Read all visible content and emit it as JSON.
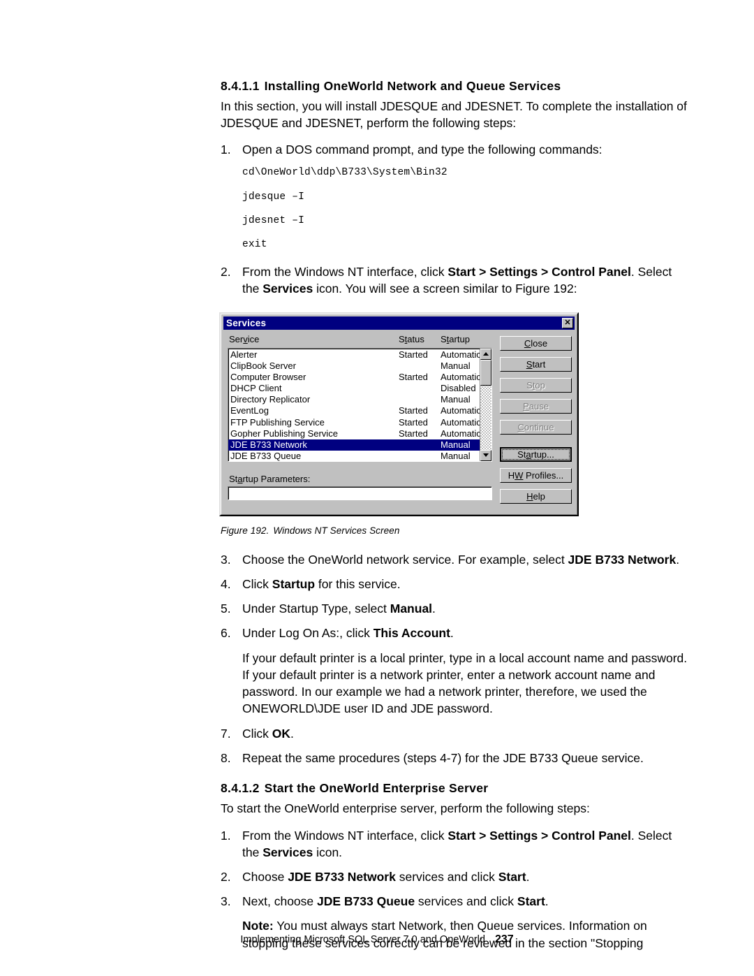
{
  "section_1": {
    "heading_number": "8.4.1.1",
    "heading_title": "Installing OneWorld Network and Queue Services",
    "intro": "In this section, you will install JDESQUE and JDESNET. To complete the installation of JDESQUE and JDESNET, perform the following steps:",
    "step1": {
      "marker": "1.",
      "text": "Open a DOS command prompt, and type the following commands:"
    },
    "commands": [
      "cd\\OneWorld\\ddp\\B733\\System\\Bin32",
      "jdesque –I",
      "jdesnet –I",
      "exit"
    ],
    "step2": {
      "marker": "2.",
      "part1": "From the Windows NT interface, click ",
      "bold1": "Start > Settings > Control Panel",
      "part2": ". Select the ",
      "bold2": "Services",
      "part3": " icon. You will see a screen similar to Figure 192:"
    },
    "step3": {
      "marker": "3.",
      "part1": "Choose the OneWorld network service. For example, select ",
      "bold1": "JDE B733 Network",
      "part2": "."
    },
    "step4": {
      "marker": "4.",
      "part1": "Click ",
      "bold1": "Startup",
      "part2": " for this service."
    },
    "step5": {
      "marker": "5.",
      "part1": "Under Startup Type, select ",
      "bold1": "Manual",
      "part2": "."
    },
    "step6": {
      "marker": "6.",
      "part1": "Under Log On As:, click ",
      "bold1": "This Account",
      "part2": "."
    },
    "printer_para": "If your default printer is a local printer, type in a local account name and password. If your default printer is a network printer, enter a network account name and password. In our example we had a network printer, therefore, we used the ONEWORLD\\JDE user ID and JDE password.",
    "step7": {
      "marker": "7.",
      "part1": "Click ",
      "bold1": "OK",
      "part2": "."
    },
    "step8": {
      "marker": "8.",
      "part1": "Repeat the same procedures (steps 4-7) for the JDE B733 Queue service.",
      "bold1": "",
      "part2": ""
    }
  },
  "figure": {
    "caption_number": "Figure 192.",
    "caption_text": "Windows NT Services Screen"
  },
  "services_dialog": {
    "title": "Services",
    "close_icon_label": "✕",
    "columns": {
      "service": {
        "pre": "Ser",
        "acc": "v",
        "post": "ice"
      },
      "status": {
        "pre": "S",
        "acc": "t",
        "post": "atus"
      },
      "startup": {
        "pre": "S",
        "acc": "t",
        "post": "artup"
      }
    },
    "rows": [
      {
        "name": "Alerter",
        "status": "Started",
        "startup": "Automatic",
        "selected": false
      },
      {
        "name": "ClipBook Server",
        "status": "",
        "startup": "Manual",
        "selected": false
      },
      {
        "name": "Computer Browser",
        "status": "Started",
        "startup": "Automatic",
        "selected": false
      },
      {
        "name": "DHCP Client",
        "status": "",
        "startup": "Disabled",
        "selected": false
      },
      {
        "name": "Directory Replicator",
        "status": "",
        "startup": "Manual",
        "selected": false
      },
      {
        "name": "EventLog",
        "status": "Started",
        "startup": "Automatic",
        "selected": false
      },
      {
        "name": "FTP Publishing Service",
        "status": "Started",
        "startup": "Automatic",
        "selected": false
      },
      {
        "name": "Gopher Publishing Service",
        "status": "Started",
        "startup": "Automatic",
        "selected": false
      },
      {
        "name": "JDE B733 Network",
        "status": "",
        "startup": "Manual",
        "selected": true
      },
      {
        "name": "JDE B733 Queue",
        "status": "",
        "startup": "Manual",
        "selected": false
      }
    ],
    "startup_parameters": {
      "label_pre": "St",
      "label_acc": "a",
      "label_post": "rtup Parameters:",
      "value": "",
      "placeholder": ""
    },
    "buttons": [
      {
        "pre": "",
        "acc": "C",
        "post": "lose",
        "disabled": false,
        "default": false
      },
      {
        "pre": "",
        "acc": "S",
        "post": "tart",
        "disabled": false,
        "default": false
      },
      {
        "pre": "S",
        "acc": "t",
        "post": "op",
        "disabled": true,
        "default": false
      },
      {
        "pre": "",
        "acc": "P",
        "post": "ause",
        "disabled": true,
        "default": false
      },
      {
        "pre": "",
        "acc": "C",
        "post": "ontinue",
        "disabled": true,
        "default": false
      },
      {
        "pre": "St",
        "acc": "a",
        "post": "rtup...",
        "disabled": false,
        "default": true
      },
      {
        "pre": "H",
        "acc": "W",
        "post": " Profiles...",
        "disabled": false,
        "default": false
      },
      {
        "pre": "",
        "acc": "H",
        "post": "elp",
        "disabled": false,
        "default": false
      }
    ],
    "colors": {
      "titlebar": "#000080",
      "face": "#c0c0c0",
      "selection": "#000080",
      "list_background": "#ffffff"
    }
  },
  "section_2": {
    "heading_number": "8.4.1.2",
    "heading_title": "Start the OneWorld Enterprise Server",
    "intro": "To start the OneWorld enterprise server, perform the following steps:",
    "step1": {
      "marker": "1.",
      "part1": "From the Windows NT interface, click ",
      "bold1": "Start > Settings > Control Panel",
      "part2": ". Select the ",
      "bold2": "Services",
      "part3": " icon."
    },
    "step2": {
      "marker": "2.",
      "part1": "Choose ",
      "bold1": "JDE B733 Network",
      "part2": " services and click ",
      "bold2": "Start",
      "part3": "."
    },
    "step3": {
      "marker": "3.",
      "part1": "Next, choose ",
      "bold1": "JDE B733 Queue",
      "part2": " services and click ",
      "bold2": "Start",
      "part3": "."
    },
    "note": {
      "label": "Note:",
      "text": " You must always start Network, then Queue services. Information on stopping these services correctly can be reviewed in the section \"Stopping"
    }
  },
  "footer": {
    "text": "Implementing Microsoft SQL Server 7.0 and OneWorld",
    "page_number": "237"
  }
}
